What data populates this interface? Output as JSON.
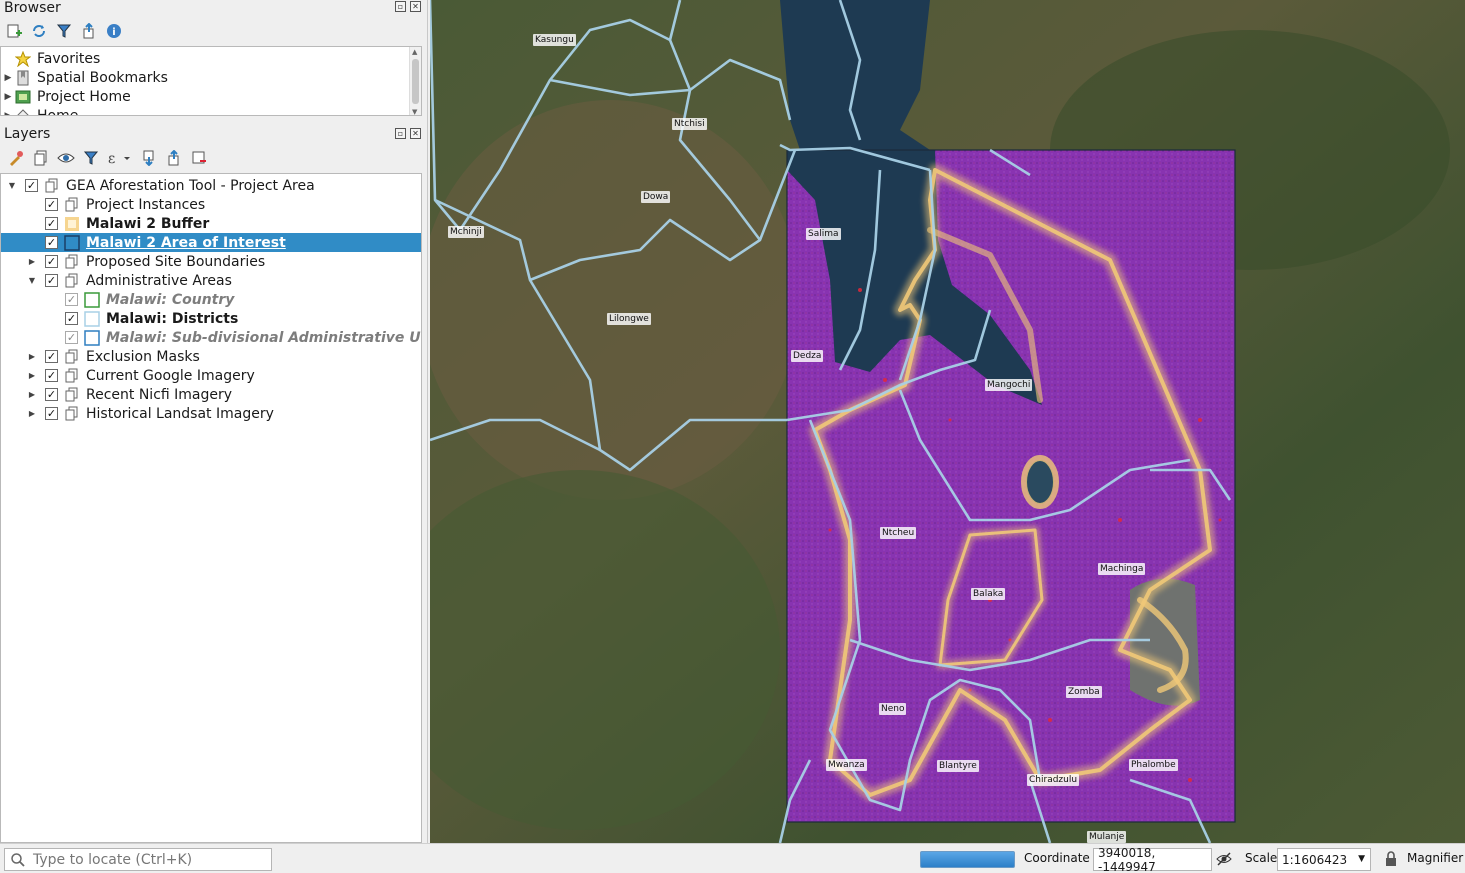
{
  "browser": {
    "title": "Browser",
    "items": [
      {
        "label": "Favorites",
        "icon": "star-icon"
      },
      {
        "label": "Spatial Bookmarks",
        "icon": "bookmark-icon"
      },
      {
        "label": "Project Home",
        "icon": "project-home-icon"
      },
      {
        "label": "Home",
        "icon": "home-folder-icon"
      }
    ]
  },
  "layers": {
    "title": "Layers",
    "items": [
      {
        "label": "GEA Aforestation Tool - Project Area"
      },
      {
        "label": "Project Instances"
      },
      {
        "label": "Malawi 2 Buffer"
      },
      {
        "label": "Malawi 2 Area of Interest"
      },
      {
        "label": "Proposed Site Boundaries"
      },
      {
        "label": "Administrative Areas"
      },
      {
        "label": "Malawi: Country"
      },
      {
        "label": "Malawi: Districts"
      },
      {
        "label": "Malawi: Sub-divisional Administrative Unit"
      },
      {
        "label": "Exclusion Masks"
      },
      {
        "label": "Current Google Imagery"
      },
      {
        "label": "Recent Nicfi Imagery"
      },
      {
        "label": "Historical Landsat Imagery"
      }
    ]
  },
  "map": {
    "labels": [
      "Kasungu",
      "Ntchisi",
      "Dowa",
      "Mchinji",
      "Salima",
      "Lilongwe",
      "Dedza",
      "Mangochi",
      "Ntcheu",
      "Balaka",
      "Machinga",
      "Zomba",
      "Neno",
      "Mwanza",
      "Blantyre",
      "Chiradzulu",
      "Phalombe",
      "Mulanje"
    ]
  },
  "statusbar": {
    "locator_placeholder": "Type to locate (Ctrl+K)",
    "coordinate_label": "Coordinate",
    "coordinate_value": "3940018, -1449947",
    "scale_label": "Scale",
    "scale_value": "1:1606423",
    "magnifier_label": "Magnifier"
  },
  "colors": {
    "selection": "#308cc6",
    "boundary": "#a8d0e6",
    "aoi_fill": "#8a2fb5",
    "buffer": "#f0c878",
    "water": "#1e3a52"
  }
}
